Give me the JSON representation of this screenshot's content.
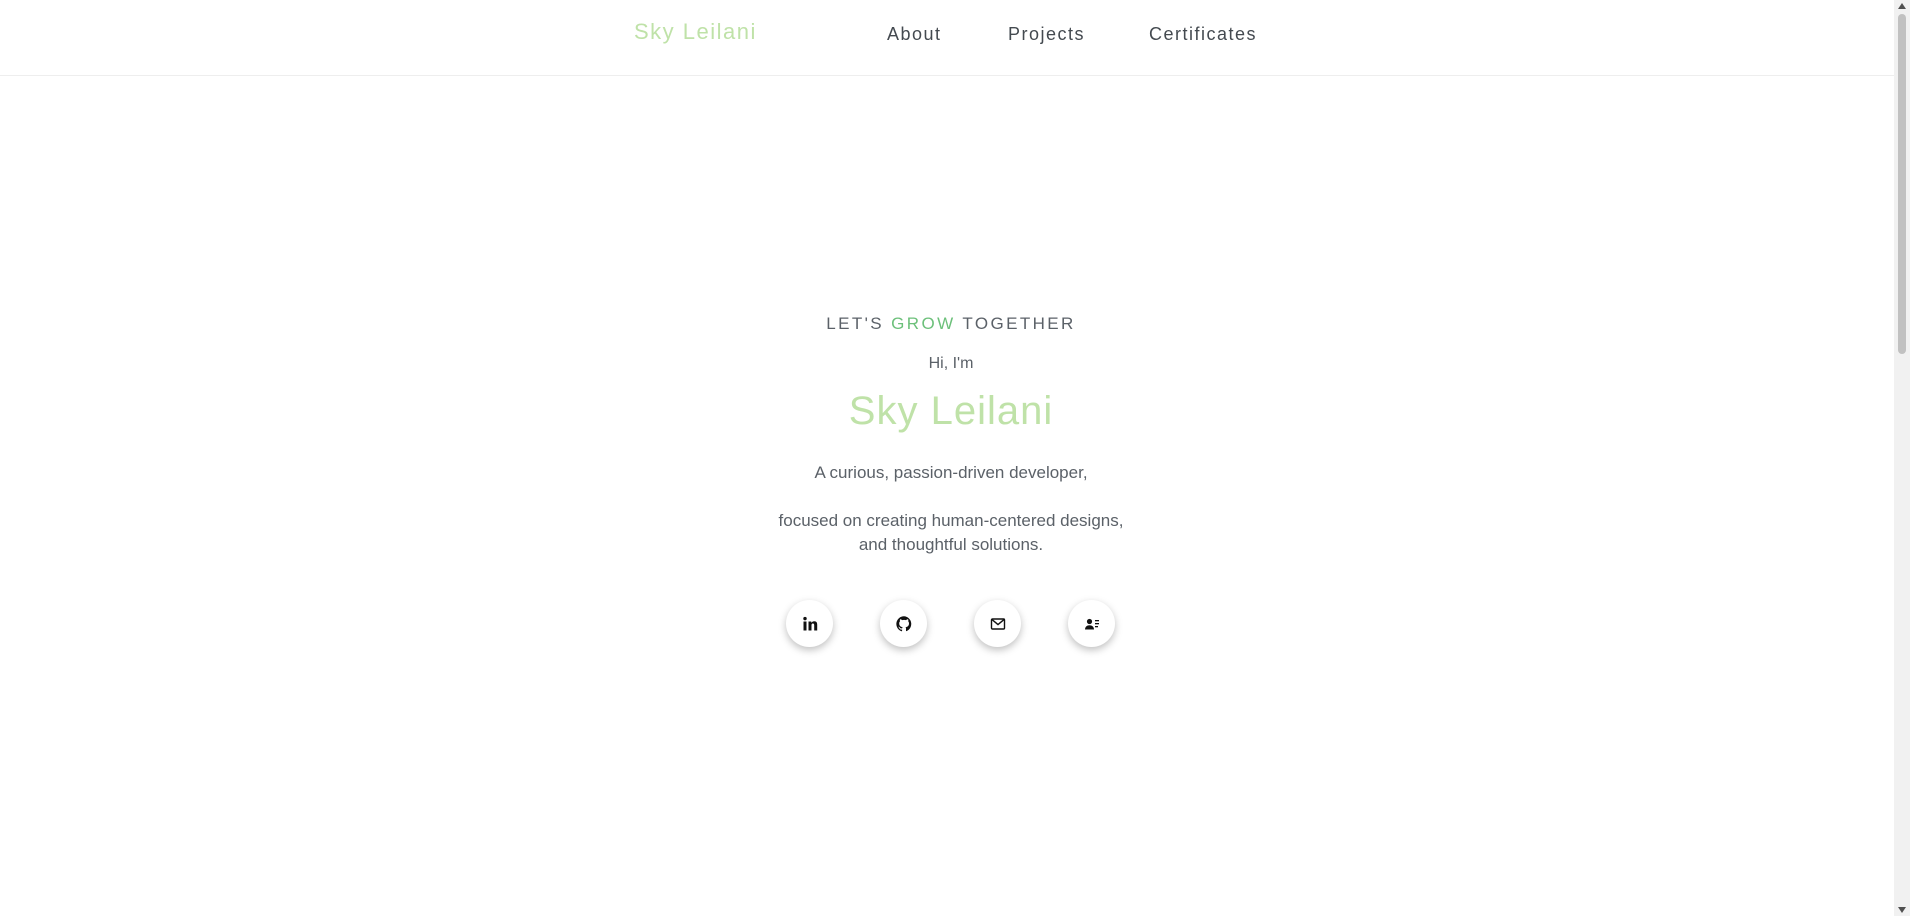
{
  "header": {
    "brand": "Sky Leilani",
    "nav": {
      "about": "About",
      "projects": "Projects",
      "certificates": "Certificates"
    }
  },
  "hero": {
    "tagline": {
      "before": "LET'S ",
      "accent": "GROW",
      "after": " TOGETHER"
    },
    "greeting": "Hi, I'm",
    "name": "Sky Leilani",
    "description": {
      "line1": "A curious, passion-driven developer,",
      "line2": "focused on creating human-centered designs,",
      "line3": "and thoughtful solutions."
    }
  },
  "social": [
    {
      "icon": "linkedin-icon"
    },
    {
      "icon": "github-icon"
    },
    {
      "icon": "email-icon"
    },
    {
      "icon": "contact-card-icon"
    }
  ],
  "colors": {
    "brand": "#bfe2a8",
    "accent": "#6cc07a",
    "text": "#5b6168",
    "nav_text": "#444a50"
  }
}
